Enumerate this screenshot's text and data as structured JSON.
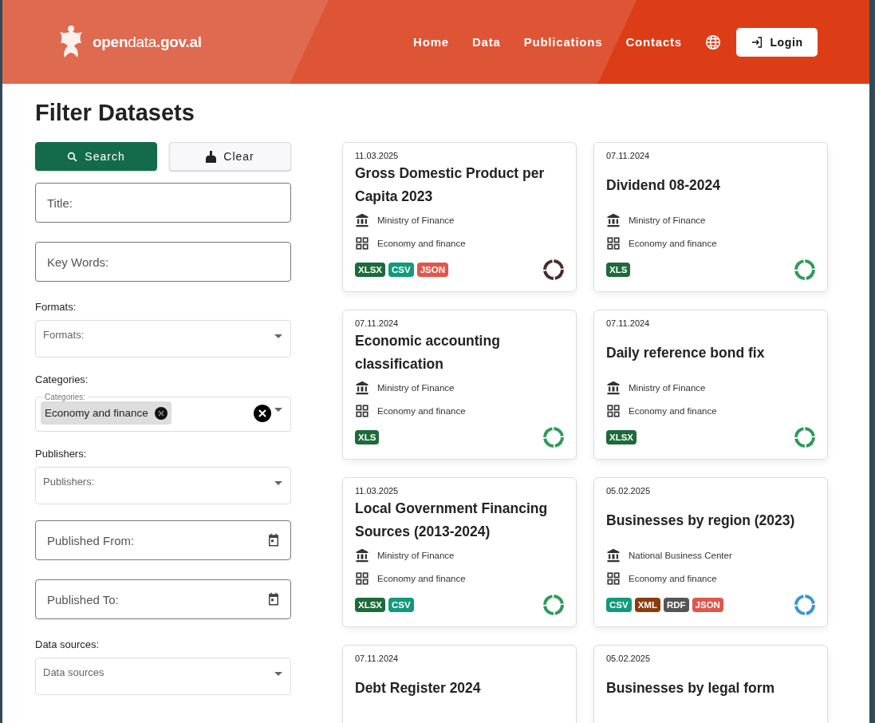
{
  "header": {
    "logo": "**open**data**.gov.al**",
    "nav": [
      {
        "label": "Home"
      },
      {
        "label": "Data"
      },
      {
        "label": "Publications"
      },
      {
        "label": "Contacts"
      }
    ],
    "login": "Login"
  },
  "filters": {
    "title": "Filter Datasets",
    "search_button": "Search",
    "clear_button": "Clear",
    "fields": [
      {
        "kind": "text",
        "placeholder": "Title:"
      },
      {
        "kind": "text",
        "placeholder": "Key Words:"
      },
      {
        "kind": "select",
        "label": "Formats:",
        "placeholder": "Formats:"
      },
      {
        "kind": "chips",
        "label": "Categories:",
        "legend": "Categories:",
        "chips": [
          "Economy and finance"
        ]
      },
      {
        "kind": "select",
        "label": "Publishers:",
        "placeholder": "Publishers:"
      },
      {
        "kind": "date",
        "placeholder": "Published From:"
      },
      {
        "kind": "date",
        "placeholder": "Published To:"
      },
      {
        "kind": "select",
        "label": "Data sources:",
        "placeholder": "Data sources"
      }
    ]
  },
  "datasets": [
    {
      "date": "11.03.2025",
      "title": "Gross Domestic Product per Capita 2023",
      "publisher": "Ministry of Finance",
      "category": "Economy and finance",
      "formats": [
        {
          "label": "XLSX",
          "color": "#1d6a3b"
        },
        {
          "label": "CSV",
          "color": "#119a7b"
        },
        {
          "label": "JSON",
          "color": "#e0564d"
        }
      ],
      "color": "#4b2a2a"
    },
    {
      "date": "07.11.2024",
      "title": "Dividend 08-2024",
      "publisher": "Ministry of Finance",
      "category": "Economy and finance",
      "formats": [
        {
          "label": "XLS",
          "color": "#1d6a3b"
        }
      ],
      "color": "#2e9a58"
    },
    {
      "date": "07.11.2024",
      "title": "Economic accounting classification",
      "publisher": "Ministry of Finance",
      "category": "Economy and finance",
      "formats": [
        {
          "label": "XLS",
          "color": "#1d6a3b"
        }
      ],
      "color": "#2e9a58"
    },
    {
      "date": "07.11.2024",
      "title": "Daily reference bond fix",
      "publisher": "Ministry of Finance",
      "category": "Economy and finance",
      "formats": [
        {
          "label": "XLSX",
          "color": "#1d6a3b"
        }
      ],
      "color": "#2e9a58"
    },
    {
      "date": "11.03.2025",
      "title": "Local Government Financing Sources (2013-2024)",
      "publisher": "Ministry of Finance",
      "category": "Economy and finance",
      "formats": [
        {
          "label": "XLSX",
          "color": "#1d6a3b"
        },
        {
          "label": "CSV",
          "color": "#119a7b"
        }
      ],
      "color": "#2e9a58"
    },
    {
      "date": "05.02.2025",
      "title": "Businesses by region (2023)",
      "publisher": "National Business Center",
      "category": "Economy and finance",
      "formats": [
        {
          "label": "CSV",
          "color": "#119a7b"
        },
        {
          "label": "XML",
          "color": "#8a3c0b"
        },
        {
          "label": "RDF",
          "color": "#555555"
        },
        {
          "label": "JSON",
          "color": "#e0564d"
        }
      ],
      "color": "#3a94d2"
    },
    {
      "date": "07.11.2024",
      "title": "Debt Register 2024"
    },
    {
      "date": "05.02.2025",
      "title": "Businesses by legal form"
    }
  ]
}
